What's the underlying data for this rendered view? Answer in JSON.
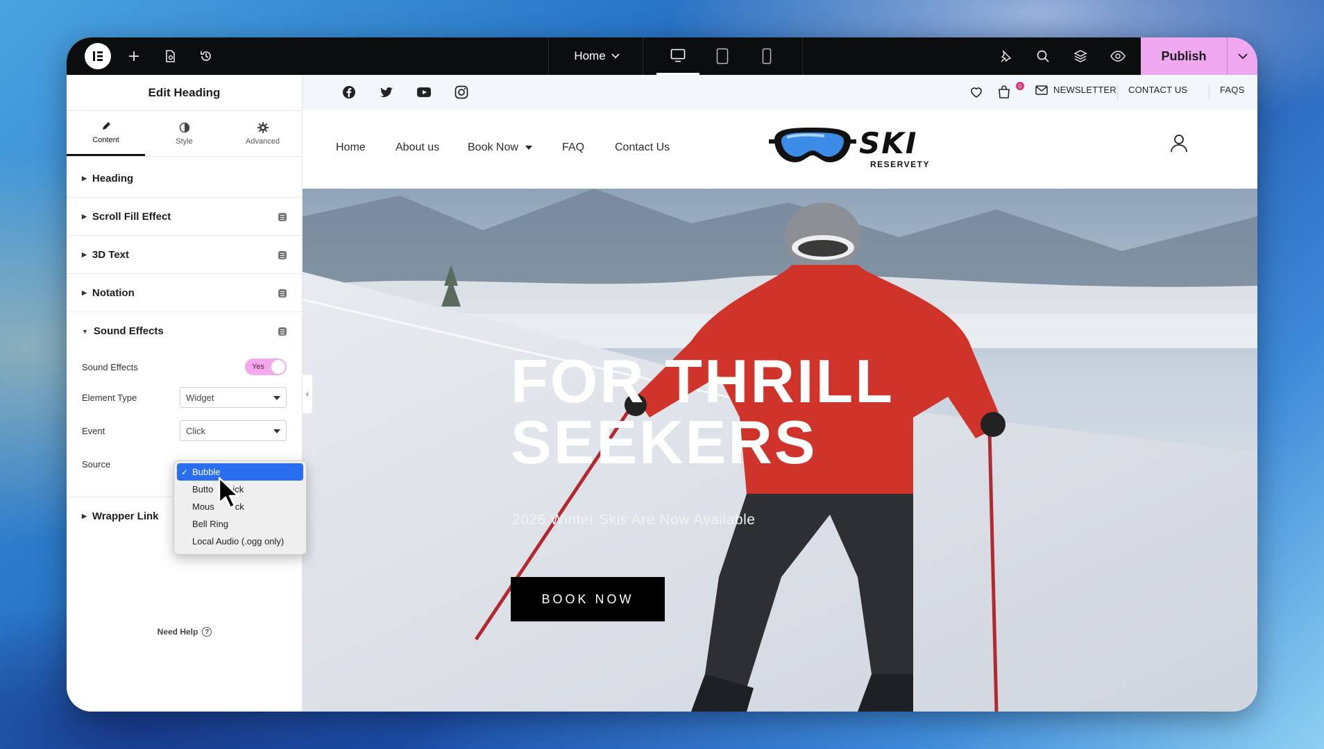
{
  "editor": {
    "page_select": "Home",
    "publish_label": "Publish"
  },
  "panel": {
    "title": "Edit Heading",
    "tabs": [
      {
        "label": "Content",
        "icon": "pencil-icon",
        "active": true
      },
      {
        "label": "Style",
        "icon": "contrast-icon",
        "active": false
      },
      {
        "label": "Advanced",
        "icon": "gear-icon",
        "active": false
      }
    ],
    "sections": {
      "heading": "Heading",
      "scroll_fill": "Scroll Fill Effect",
      "text3d": "3D Text",
      "notation": "Notation",
      "sound_effects": "Sound Effects",
      "wrapper_link": "Wrapper Link"
    },
    "controls": {
      "sound_effects_label": "Sound Effects",
      "sound_effects_value": "Yes",
      "element_type_label": "Element Type",
      "element_type_value": "Widget",
      "event_label": "Event",
      "event_value": "Click",
      "source_label": "Source"
    },
    "need_help": "Need Help"
  },
  "dropdown": {
    "options": [
      "Bubble",
      "Button Click",
      "Mouse Click",
      "Bell Ring",
      "Local Audio (.ogg only)"
    ],
    "visible": [
      "Bubble",
      "Butto",
      "ick",
      "Mous",
      "ck",
      "Bell Ring",
      "Local Audio (.ogg only)"
    ],
    "selected": "Bubble"
  },
  "site": {
    "topbar": {
      "cart_count": "0",
      "newsletter": "NEWSLETTER",
      "contact": "CONTACT US",
      "faqs": "FAQS"
    },
    "nav": [
      "Home",
      "About us",
      "Book Now",
      "FAQ",
      "Contact Us"
    ],
    "logo": {
      "main": "SKI",
      "sub": "RESERVETY"
    },
    "hero": {
      "title_line1": "FOR THRILL",
      "title_line2": "SEEKERS",
      "subtitle": "2026 Winter Skis Are Now Available",
      "cta": "BOOK NOW"
    }
  },
  "colors": {
    "publish": "#f0a8f0",
    "toggle": "#f6a8ec",
    "dropdown_selected": "#2a6ef0",
    "topbar": "#0c0d0e"
  }
}
